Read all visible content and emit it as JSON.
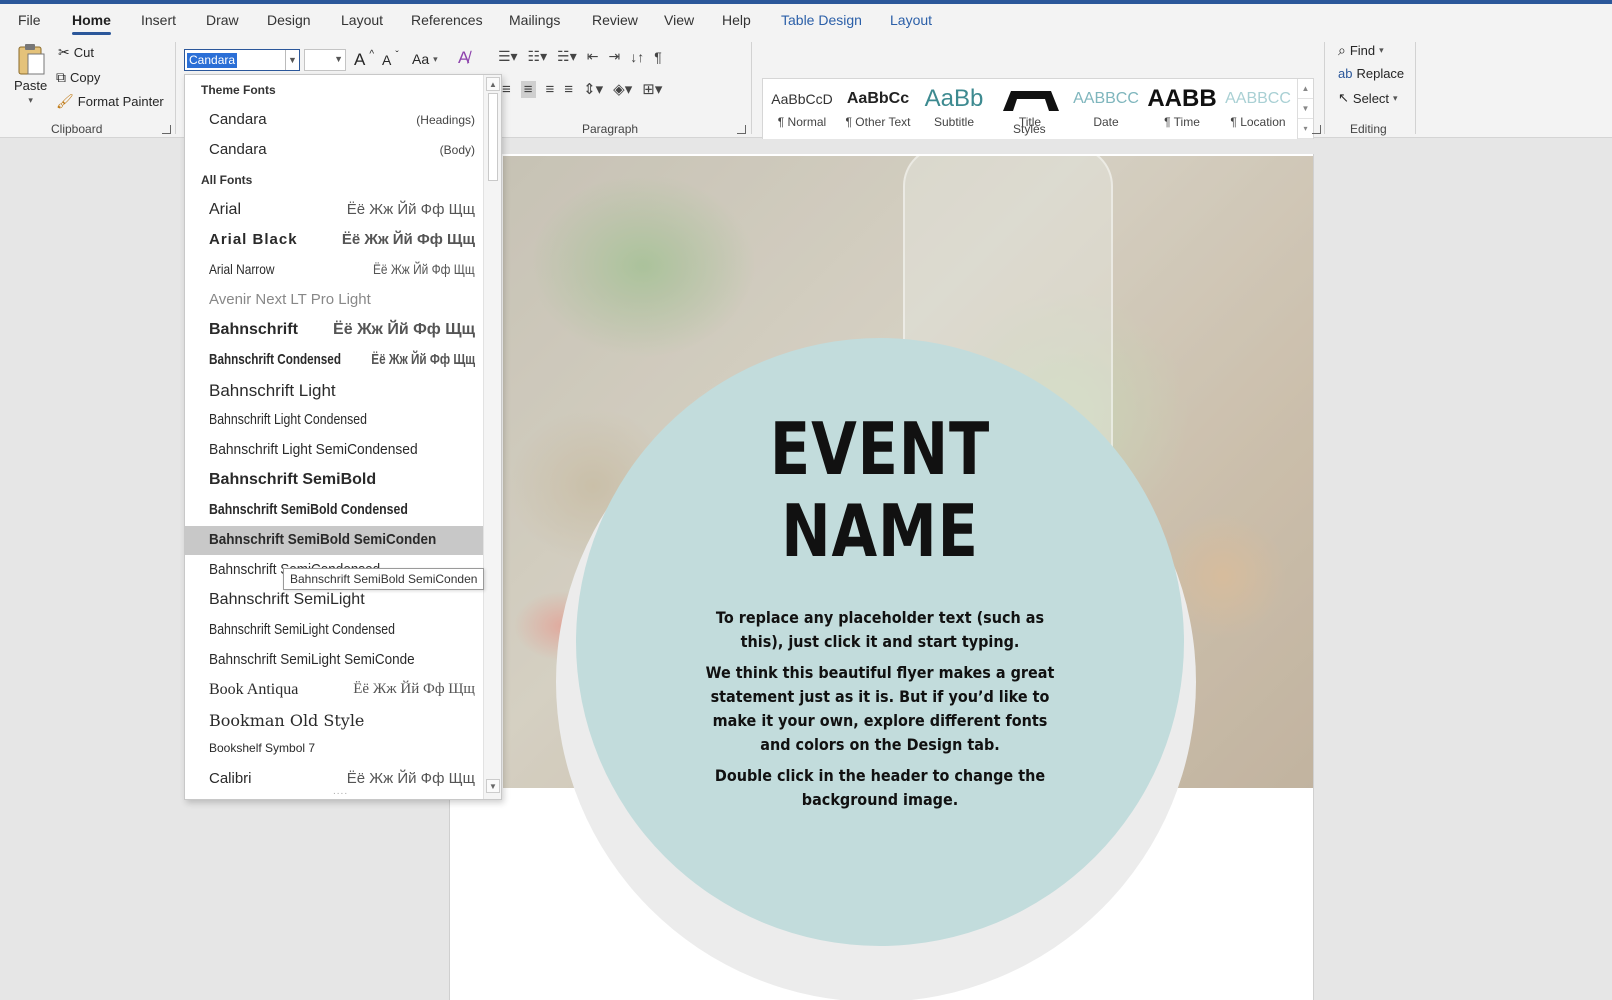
{
  "tabs": {
    "file": "File",
    "home": "Home",
    "insert": "Insert",
    "draw": "Draw",
    "design": "Design",
    "layout": "Layout",
    "references": "References",
    "mailings": "Mailings",
    "review": "Review",
    "view": "View",
    "help": "Help",
    "table_design": "Table Design",
    "table_layout": "Layout"
  },
  "clipboard": {
    "paste": "Paste",
    "cut": "Cut",
    "copy": "Copy",
    "format_painter": "Format Painter",
    "label": "Clipboard"
  },
  "font_group": {
    "font_name": "Candara",
    "size": "",
    "grow": "A",
    "shrink": "A",
    "change_case": "Aa"
  },
  "paragraph": {
    "label": "Paragraph"
  },
  "styles": {
    "label": "Styles",
    "items": [
      {
        "preview": "AaBbCcD",
        "name": "¶ Normal"
      },
      {
        "preview": "AaBbCc",
        "name": "¶ Other Text"
      },
      {
        "preview": "AaBb",
        "name": "Subtitle"
      },
      {
        "preview": "",
        "name": "Title"
      },
      {
        "preview": "AABBCC",
        "name": "Date"
      },
      {
        "preview": "AABB",
        "name": "¶ Time"
      },
      {
        "preview": "AABBCC",
        "name": "¶ Location"
      }
    ]
  },
  "editing": {
    "label": "Editing",
    "find": "Find",
    "replace": "Replace",
    "select": "Select"
  },
  "dropdown": {
    "theme_header": "Theme Fonts",
    "theme_fonts": [
      {
        "name": "Candara",
        "tag": "(Headings)"
      },
      {
        "name": "Candara",
        "tag": "(Body)"
      }
    ],
    "all_header": "All Fonts",
    "fonts": [
      {
        "name": "Arial",
        "sample": "Ёё Жж Йй Фф Щщ"
      },
      {
        "name": "Arial Black",
        "sample": "Ёё Жж Йй Фф Щщ"
      },
      {
        "name": "Arial Narrow",
        "sample": "Ёё Жж Йй Фф Щщ"
      },
      {
        "name": "Avenir Next LT Pro Light",
        "sample": ""
      },
      {
        "name": "Bahnschrift",
        "sample": "Ёё Жж Йй Фф Щщ"
      },
      {
        "name": "Bahnschrift Condensed",
        "sample": "Ёё Жж Йй Фф Щщ"
      },
      {
        "name": "Bahnschrift Light",
        "sample": ""
      },
      {
        "name": "Bahnschrift Light Condensed",
        "sample": ""
      },
      {
        "name": "Bahnschrift Light SemiCondensed",
        "sample": ""
      },
      {
        "name": "Bahnschrift SemiBold",
        "sample": ""
      },
      {
        "name": "Bahnschrift SemiBold Condensed",
        "sample": ""
      },
      {
        "name": "Bahnschrift SemiBold SemiConden",
        "sample": ""
      },
      {
        "name": "Bahnschrift SemiCondensed",
        "sample": ""
      },
      {
        "name": "Bahnschrift SemiLight",
        "sample": ""
      },
      {
        "name": "Bahnschrift SemiLight Condensed",
        "sample": ""
      },
      {
        "name": "Bahnschrift SemiLight SemiConde",
        "sample": ""
      },
      {
        "name": "Book Antiqua",
        "sample": "Ёё Жж Йй Фф Щщ"
      },
      {
        "name": "Bookman Old Style",
        "sample": ""
      },
      {
        "name": "Bookshelf Symbol 7",
        "sample": ""
      },
      {
        "name": "Calibri",
        "sample": "Ёё Жж Йй Фф Щщ"
      }
    ],
    "grip": "....",
    "tooltip": "Bahnschrift SemiBold SemiConden"
  },
  "document": {
    "title_line1": "EVENT",
    "title_line2": "NAME",
    "para1": "To replace any placeholder text (such as this), just click it and start typing.",
    "para2": "We think this beautiful flyer makes a great statement just as it is.  But if you’d like to make it your own, explore different fonts and colors on the Design tab.",
    "para3": "Double click in the header to change the background image."
  },
  "colors": {
    "accent": "#2b579a",
    "circle": "#c2dcdc",
    "highlight": "#c8c8c8",
    "selection": "#2b6fd6"
  }
}
